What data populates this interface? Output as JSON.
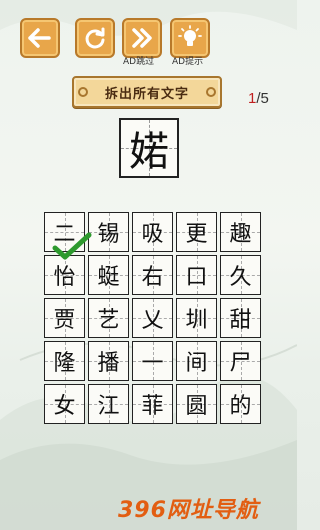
{
  "toolbar": {
    "skip_label": "AD跳过",
    "hint_label": "AD提示"
  },
  "banner": {
    "text": "拆出所有文字"
  },
  "progress": {
    "current": "1",
    "total": "/5"
  },
  "target_char": "婼",
  "grid": {
    "rows": [
      [
        "二",
        "锡",
        "吸",
        "更",
        "趣"
      ],
      [
        "怡",
        "蜓",
        "右",
        "口",
        "久"
      ],
      [
        "贾",
        "艺",
        "乂",
        "圳",
        "甜"
      ],
      [
        "隆",
        "播",
        "一",
        "间",
        "尸"
      ],
      [
        "女",
        "江",
        "菲",
        "圆",
        "的"
      ]
    ]
  },
  "colors": {
    "button": "#e8a64a",
    "check": "#2e9a2e",
    "accent": "#c02020",
    "watermark": "#e25e12"
  },
  "icons": [
    "back-arrow-icon",
    "refresh-icon",
    "fast-forward-icon",
    "lightbulb-icon",
    "check-icon"
  ],
  "watermark": {
    "text": "396网址导航"
  }
}
